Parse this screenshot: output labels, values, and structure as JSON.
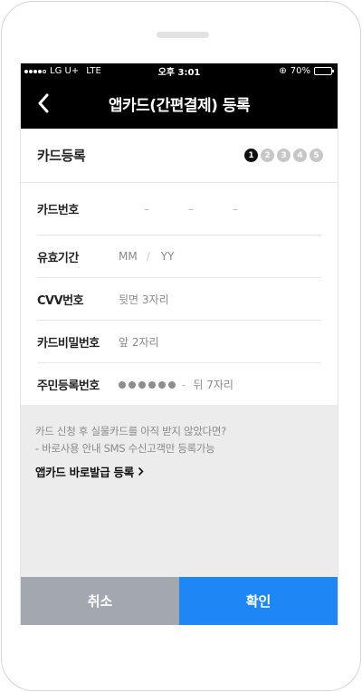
{
  "status_bar": {
    "carrier": "LG U+",
    "network": "LTE",
    "time": "오후 3:01",
    "battery_text": "70%",
    "battery_level": 0.7
  },
  "header": {
    "title": "앱카드(간편결제) 등록",
    "back_icon": "chevron-left-icon"
  },
  "section": {
    "title": "카드등록",
    "steps": [
      "1",
      "2",
      "3",
      "4",
      "5"
    ],
    "active_step": 1
  },
  "form": {
    "card_number": {
      "label": "카드번호",
      "dashes": [
        "–",
        "–",
        "–"
      ]
    },
    "expiry": {
      "label": "유효기간",
      "month_placeholder": "MM",
      "separator": "/",
      "year_placeholder": "YY"
    },
    "cvv": {
      "label": "CVV번호",
      "placeholder": "뒷면 3자리"
    },
    "password": {
      "label": "카드비밀번호",
      "placeholder": "앞 2자리"
    },
    "resident": {
      "label": "주민등록번호",
      "dash": "-",
      "placeholder": "뒤 7자리"
    }
  },
  "info": {
    "line1": "카드 신청 후 실물카드를 아직 받지 않았다면?",
    "line2": "- 바로사용 안내 SMS 수신고객만 등록가능",
    "link_label": "앱카드 바로발급 등록",
    "link_icon": "chevron-right-icon"
  },
  "buttons": {
    "cancel": "취소",
    "confirm": "확인"
  },
  "colors": {
    "header_bg": "#000000",
    "cancel_bg": "#a3a8b0",
    "confirm_bg": "#1e87f5",
    "info_bg": "#ececec"
  }
}
